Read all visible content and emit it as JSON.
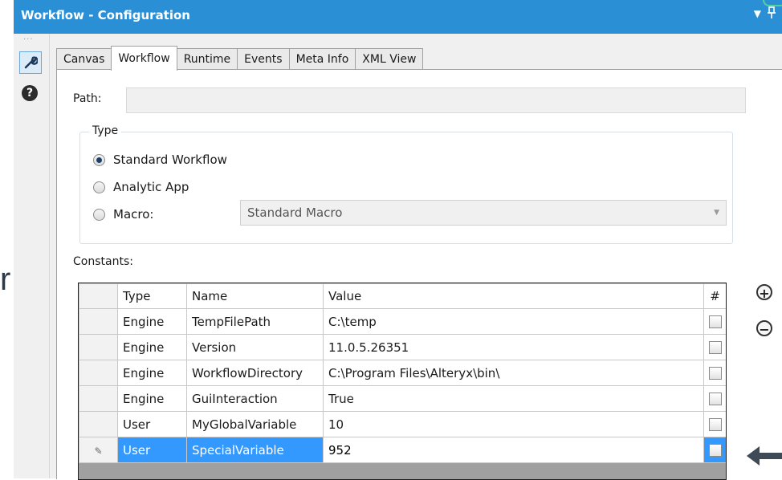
{
  "window": {
    "title": "Workflow - Configuration",
    "pin_glyph": "▾ ⊥"
  },
  "left_overflow_text": "r",
  "sidebar": {
    "items": [
      {
        "icon": "wrench-icon",
        "active": true
      },
      {
        "icon": "help-icon",
        "label": "?"
      }
    ]
  },
  "tabs": [
    {
      "label": "Canvas",
      "active": false
    },
    {
      "label": "Workflow",
      "active": true
    },
    {
      "label": "Runtime",
      "active": false
    },
    {
      "label": "Events",
      "active": false
    },
    {
      "label": "Meta Info",
      "active": false
    },
    {
      "label": "XML View",
      "active": false
    }
  ],
  "path": {
    "label": "Path:",
    "value": ""
  },
  "type_group": {
    "legend": "Type",
    "options": [
      {
        "label": "Standard Workflow",
        "checked": true
      },
      {
        "label": "Analytic App",
        "checked": false
      },
      {
        "label": "Macro:",
        "checked": false
      }
    ],
    "macro_select": "Standard Macro"
  },
  "constants": {
    "label": "Constants:",
    "columns": [
      "Type",
      "Name",
      "Value",
      "#"
    ],
    "rows": [
      {
        "type": "Engine",
        "name": "TempFilePath",
        "value": "C:\\temp",
        "checked": false
      },
      {
        "type": "Engine",
        "name": "Version",
        "value": "11.0.5.26351",
        "checked": false
      },
      {
        "type": "Engine",
        "name": "WorkflowDirectory",
        "value": "C:\\Program Files\\Alteryx\\bin\\",
        "checked": false
      },
      {
        "type": "Engine",
        "name": "GuiInteraction",
        "value": "True",
        "checked": false
      },
      {
        "type": "User",
        "name": "MyGlobalVariable",
        "value": "10",
        "checked": false
      },
      {
        "type": "User",
        "name": "SpecialVariable",
        "value": "952",
        "checked": false,
        "selected": true
      }
    ]
  },
  "buttons": {
    "add": "+",
    "remove": "−"
  },
  "colors": {
    "titlebar": "#2b8fd6",
    "selection": "#3399ff"
  }
}
